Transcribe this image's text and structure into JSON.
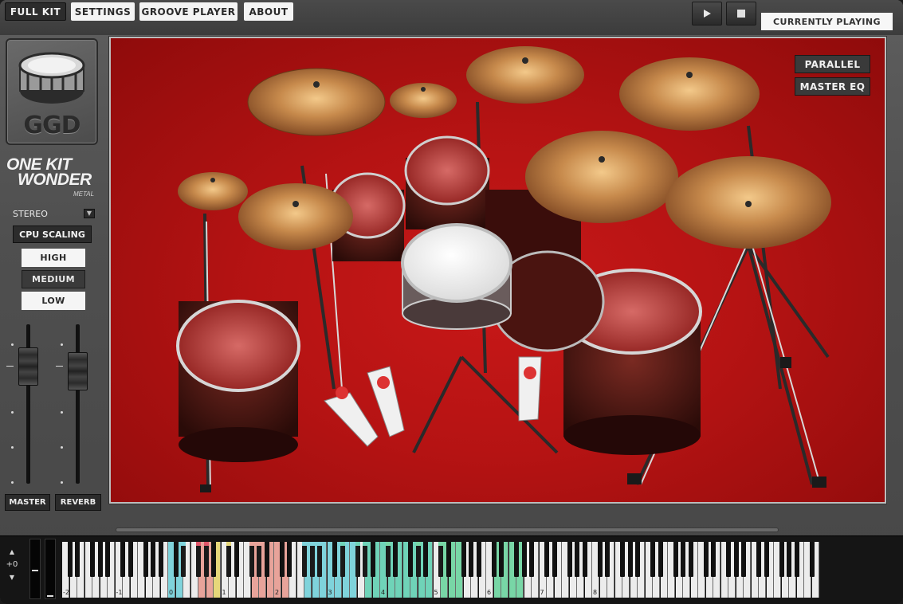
{
  "tabs": [
    {
      "label": "FULL KIT",
      "active": true
    },
    {
      "label": "SETTINGS",
      "active": false
    },
    {
      "label": "GROOVE PLAYER",
      "active": false
    },
    {
      "label": "ABOUT",
      "active": false
    }
  ],
  "transport": {
    "play_icon": "play-icon",
    "stop_icon": "stop-icon",
    "currently_playing": "CURRENTLY PLAYING"
  },
  "logo": {
    "ggd": "GGD",
    "line1": "ONE KIT",
    "line2": "WONDER",
    "edition": "METAL"
  },
  "stereo": {
    "label": "STEREO",
    "icon": "stereo-toggle-icon"
  },
  "cpu_scaling": {
    "label": "CPU SCALING",
    "options": [
      "HIGH",
      "MEDIUM",
      "LOW"
    ],
    "selected": "MEDIUM"
  },
  "faders": {
    "master_label": "MASTER",
    "reverb_label": "REVERB"
  },
  "stage": {
    "parallel_label": "PARALLEL",
    "master_eq_label": "MASTER EQ",
    "background_color": "#c0161a"
  },
  "keyboard": {
    "octave_up": "▲",
    "octave_down": "▼",
    "octave_shift": "+0",
    "octave_labels": [
      "-2",
      "-1",
      "0",
      "1",
      "2",
      "3",
      "4",
      "5",
      "6",
      "7",
      "8"
    ],
    "mapped_colors": {
      "cyan": "#7fd3db",
      "salmon": "#e8a39a",
      "red": "#e0566a",
      "yellow": "#e6d77a",
      "teal": "#6fd3b8",
      "green": "#78d6a6",
      "orange": "#f0a07a"
    }
  }
}
